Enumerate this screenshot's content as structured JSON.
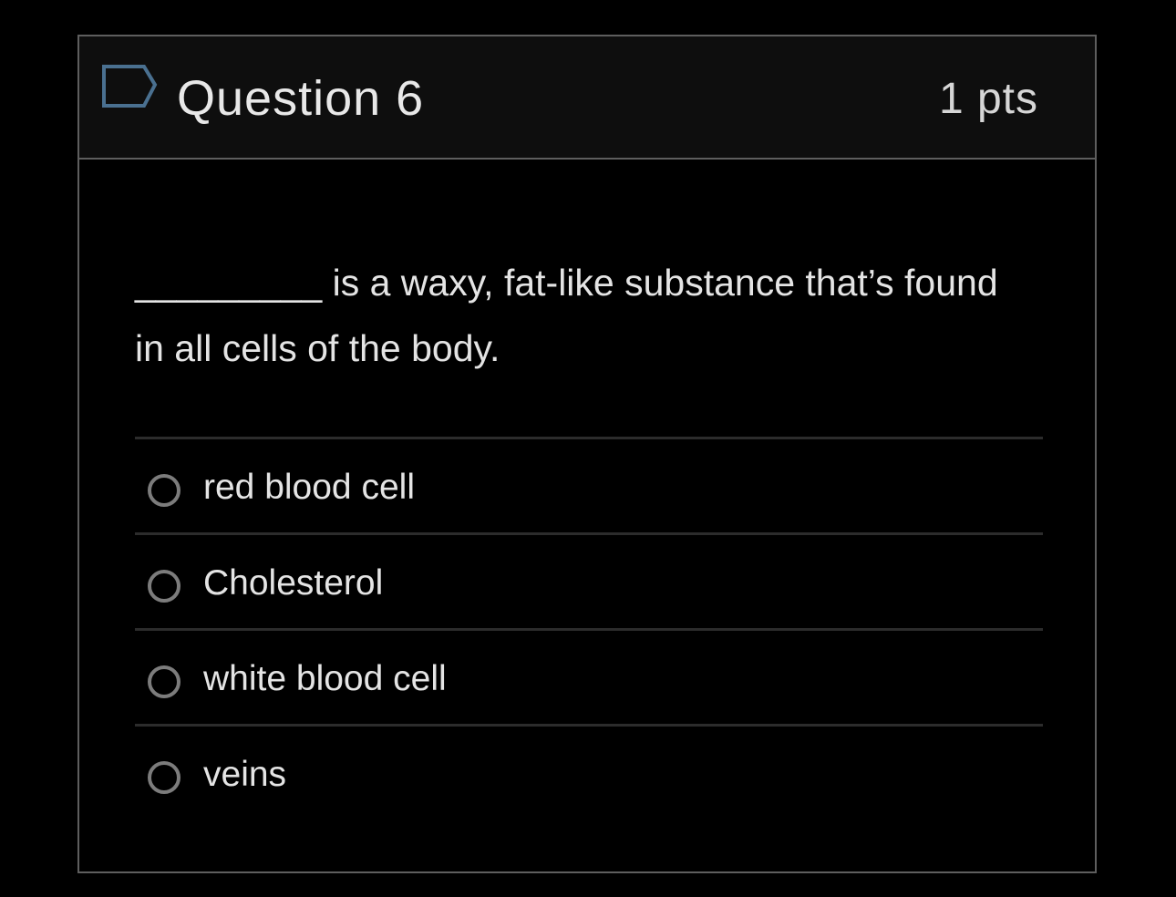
{
  "question": {
    "title": "Question 6",
    "points": "1 pts",
    "flag_icon": "flag-icon",
    "text": "_________ is a waxy, fat-like substance that’s found in all cells of the body.",
    "answers": [
      {
        "label": "red blood cell",
        "selected": false
      },
      {
        "label": "Cholesterol",
        "selected": false
      },
      {
        "label": "white blood cell",
        "selected": false
      },
      {
        "label": "veins",
        "selected": false
      }
    ]
  },
  "colors": {
    "background": "#000000",
    "header_background": "#0e0e0e",
    "border": "#5e5e5e",
    "divider": "#2c2c2c",
    "text": "#e4e4e4",
    "flag_stroke": "#4a7090",
    "radio_border": "#7c7c7c"
  }
}
